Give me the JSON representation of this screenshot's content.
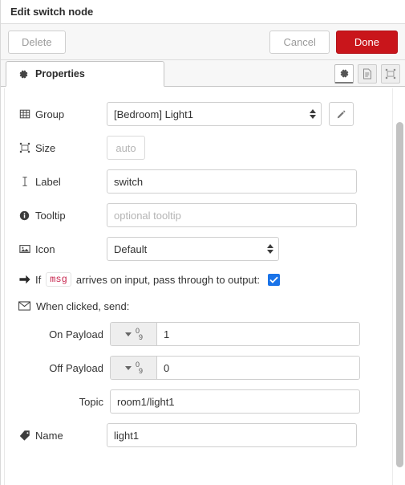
{
  "window": {
    "title": "Edit switch node"
  },
  "actions": {
    "delete_label": "Delete",
    "cancel_label": "Cancel",
    "done_label": "Done",
    "done_color": "#c9151b"
  },
  "tabs": [
    {
      "label": "Properties",
      "icon": "gear-icon",
      "active": true
    }
  ],
  "tab_tools": [
    {
      "name": "properties-tool",
      "icon": "gear-icon",
      "active": true
    },
    {
      "name": "description-tool",
      "icon": "document-icon",
      "active": false
    },
    {
      "name": "appearance-tool",
      "icon": "appearance-icon",
      "active": false
    }
  ],
  "form": {
    "group": {
      "label": "Group",
      "icon": "table-grid-icon",
      "value": "[Bedroom] Light1",
      "options": [
        "[Bedroom] Light1"
      ],
      "edit_button_icon": "pencil-icon"
    },
    "size": {
      "label": "Size",
      "icon": "resize-icon",
      "value": "auto"
    },
    "label_field": {
      "label": "Label",
      "icon": "text-cursor-icon",
      "value": "switch",
      "placeholder": ""
    },
    "tooltip": {
      "label": "Tooltip",
      "icon": "info-circle-icon",
      "value": "",
      "placeholder": "optional tooltip"
    },
    "icon_field": {
      "label": "Icon",
      "icon": "image-icon",
      "value": "Default",
      "options": [
        "Default"
      ]
    },
    "passthrough": {
      "icon": "arrow-right-icon",
      "prefix": "If",
      "code": "msg",
      "suffix": "arrives on input, pass through to output:",
      "checked": true,
      "checkbox_color": "#1a73e8"
    },
    "when_clicked": {
      "icon": "envelope-icon",
      "label": "When clicked, send:"
    },
    "on_payload": {
      "label": "On Payload",
      "type": "num",
      "type_glyph": "0 9",
      "value": "1"
    },
    "off_payload": {
      "label": "Off Payload",
      "type": "num",
      "type_glyph": "0 9",
      "value": "0"
    },
    "topic": {
      "label": "Topic",
      "value": "room1/light1",
      "placeholder": ""
    },
    "name": {
      "label": "Name",
      "icon": "tag-icon",
      "value": "light1",
      "placeholder": ""
    }
  }
}
